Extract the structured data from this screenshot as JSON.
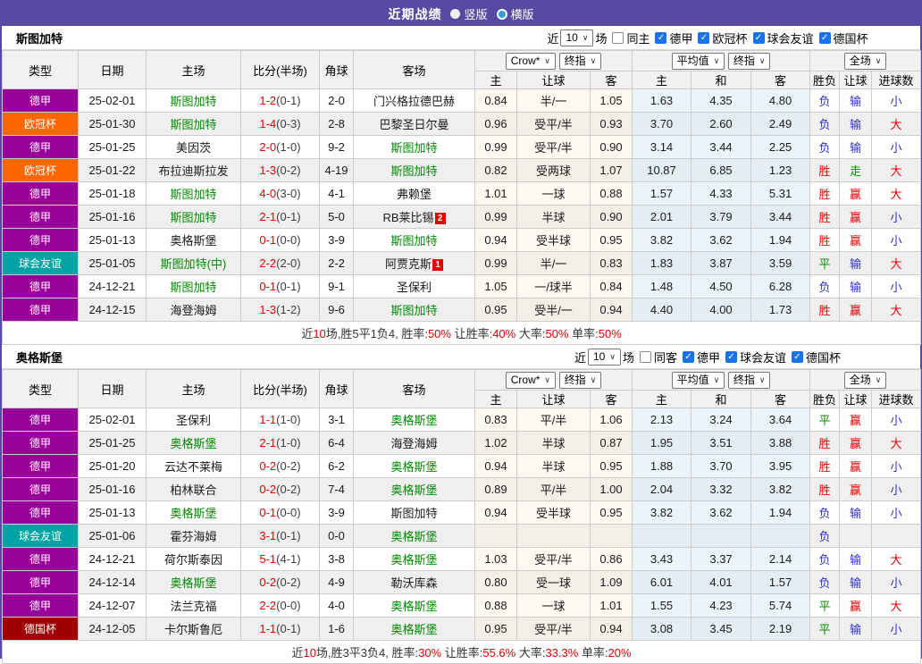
{
  "header": {
    "title": "近期战绩",
    "options": [
      {
        "label": "竖版",
        "selected": true
      },
      {
        "label": "横版",
        "selected": false
      }
    ]
  },
  "colors": {
    "titlebar_bg": "#564AA3",
    "type_colors": {
      "德甲": "#990099",
      "欧冠杯": "#FF6600",
      "球会友谊": "#00A3A3",
      "德国杯": "#A00000"
    },
    "team_highlight": "#008A00",
    "score_red": "#E60000",
    "result_colors": {
      "胜": "#E60000",
      "平": "#009000",
      "负": "#3030CF",
      "赢": "#E60000",
      "走": "#009000",
      "输": "#3030CF",
      "大": "#E60000",
      "小": "#3030CF"
    }
  },
  "columns": {
    "left": [
      "类型",
      "日期",
      "主场",
      "比分(半场)",
      "角球",
      "客场"
    ],
    "group1_selects": [
      "Crow*",
      "终指"
    ],
    "group2_selects": [
      "平均值",
      "终指"
    ],
    "group3_selects": [
      "全场"
    ],
    "sub": [
      "主",
      "让球",
      "客",
      "主",
      "和",
      "客",
      "胜负",
      "让球",
      "进球数"
    ]
  },
  "tables": [
    {
      "team": "斯图加特",
      "filter": {
        "prefix": "近",
        "matches": "10",
        "suffix": "场",
        "same_label": "同主",
        "same_checked": false,
        "leagues": [
          {
            "label": "德甲",
            "checked": true
          },
          {
            "label": "欧冠杯",
            "checked": true
          },
          {
            "label": "球会友谊",
            "checked": true
          },
          {
            "label": "德国杯",
            "checked": true
          }
        ]
      },
      "rows": [
        {
          "league": "德甲",
          "date": "25-02-01",
          "home": "斯图加特",
          "home_is_team": true,
          "score": "1-2",
          "half_score": "(0-1)",
          "corners": "2-0",
          "away": "门兴格拉德巴赫",
          "away_is_team": false,
          "away_red_card": "",
          "odds": {
            "home": "0.84",
            "handicap": "半/一",
            "away": "1.05"
          },
          "avg": {
            "home": "1.63",
            "draw": "4.35",
            "away": "4.80"
          },
          "results": {
            "outcome": "负",
            "handicap": "输",
            "goals": "小"
          }
        },
        {
          "league": "欧冠杯",
          "date": "25-01-30",
          "home": "斯图加特",
          "home_is_team": true,
          "score": "1-4",
          "half_score": "(0-3)",
          "corners": "2-8",
          "away": "巴黎圣日尔曼",
          "away_is_team": false,
          "away_red_card": "",
          "odds": {
            "home": "0.96",
            "handicap": "受平/半",
            "away": "0.93"
          },
          "avg": {
            "home": "3.70",
            "draw": "2.60",
            "away": "2.49"
          },
          "results": {
            "outcome": "负",
            "handicap": "输",
            "goals": "大"
          }
        },
        {
          "league": "德甲",
          "date": "25-01-25",
          "home": "美因茨",
          "home_is_team": false,
          "score": "2-0",
          "half_score": "(1-0)",
          "corners": "9-2",
          "away": "斯图加特",
          "away_is_team": true,
          "away_red_card": "",
          "odds": {
            "home": "0.99",
            "handicap": "受平/半",
            "away": "0.90"
          },
          "avg": {
            "home": "3.14",
            "draw": "3.44",
            "away": "2.25"
          },
          "results": {
            "outcome": "负",
            "handicap": "输",
            "goals": "小"
          }
        },
        {
          "league": "欧冠杯",
          "date": "25-01-22",
          "home": "布拉迪斯拉发",
          "home_is_team": false,
          "score": "1-3",
          "half_score": "(0-2)",
          "corners": "4-19",
          "away": "斯图加特",
          "away_is_team": true,
          "away_red_card": "",
          "odds": {
            "home": "0.82",
            "handicap": "受两球",
            "away": "1.07"
          },
          "avg": {
            "home": "10.87",
            "draw": "6.85",
            "away": "1.23"
          },
          "results": {
            "outcome": "胜",
            "handicap": "走",
            "goals": "大"
          }
        },
        {
          "league": "德甲",
          "date": "25-01-18",
          "home": "斯图加特",
          "home_is_team": true,
          "score": "4-0",
          "half_score": "(3-0)",
          "corners": "4-1",
          "away": "弗赖堡",
          "away_is_team": false,
          "away_red_card": "",
          "odds": {
            "home": "1.01",
            "handicap": "一球",
            "away": "0.88"
          },
          "avg": {
            "home": "1.57",
            "draw": "4.33",
            "away": "5.31"
          },
          "results": {
            "outcome": "胜",
            "handicap": "赢",
            "goals": "大"
          }
        },
        {
          "league": "德甲",
          "date": "25-01-16",
          "home": "斯图加特",
          "home_is_team": true,
          "score": "2-1",
          "half_score": "(0-1)",
          "corners": "5-0",
          "away": "RB莱比锡",
          "away_is_team": false,
          "away_red_card": "2",
          "odds": {
            "home": "0.99",
            "handicap": "半球",
            "away": "0.90"
          },
          "avg": {
            "home": "2.01",
            "draw": "3.79",
            "away": "3.44"
          },
          "results": {
            "outcome": "胜",
            "handicap": "赢",
            "goals": "小"
          }
        },
        {
          "league": "德甲",
          "date": "25-01-13",
          "home": "奥格斯堡",
          "home_is_team": false,
          "score": "0-1",
          "half_score": "(0-0)",
          "corners": "3-9",
          "away": "斯图加特",
          "away_is_team": true,
          "away_red_card": "",
          "odds": {
            "home": "0.94",
            "handicap": "受半球",
            "away": "0.95"
          },
          "avg": {
            "home": "3.82",
            "draw": "3.62",
            "away": "1.94"
          },
          "results": {
            "outcome": "胜",
            "handicap": "赢",
            "goals": "小"
          }
        },
        {
          "league": "球会友谊",
          "date": "25-01-05",
          "home": "斯图加特(中)",
          "home_is_team": true,
          "score": "2-2",
          "half_score": "(2-0)",
          "corners": "2-2",
          "away": "阿贾克斯",
          "away_is_team": false,
          "away_red_card": "1",
          "odds": {
            "home": "0.99",
            "handicap": "半/一",
            "away": "0.83"
          },
          "avg": {
            "home": "1.83",
            "draw": "3.87",
            "away": "3.59"
          },
          "results": {
            "outcome": "平",
            "handicap": "输",
            "goals": "大"
          }
        },
        {
          "league": "德甲",
          "date": "24-12-21",
          "home": "斯图加特",
          "home_is_team": true,
          "score": "0-1",
          "half_score": "(0-1)",
          "corners": "9-1",
          "away": "圣保利",
          "away_is_team": false,
          "away_red_card": "",
          "odds": {
            "home": "1.05",
            "handicap": "一/球半",
            "away": "0.84"
          },
          "avg": {
            "home": "1.48",
            "draw": "4.50",
            "away": "6.28"
          },
          "results": {
            "outcome": "负",
            "handicap": "输",
            "goals": "小"
          }
        },
        {
          "league": "德甲",
          "date": "24-12-15",
          "home": "海登海姆",
          "home_is_team": false,
          "score": "1-3",
          "half_score": "(1-2)",
          "corners": "9-6",
          "away": "斯图加特",
          "away_is_team": true,
          "away_red_card": "",
          "odds": {
            "home": "0.95",
            "handicap": "受半/一",
            "away": "0.94"
          },
          "avg": {
            "home": "4.40",
            "draw": "4.00",
            "away": "1.73"
          },
          "results": {
            "outcome": "胜",
            "handicap": "赢",
            "goals": "大"
          }
        }
      ],
      "summary": [
        {
          "text": "近"
        },
        {
          "text": "10",
          "red": true
        },
        {
          "text": "场,胜5平1负4, 胜率:"
        },
        {
          "text": "50%",
          "red": true
        },
        {
          "text": " 让胜率:"
        },
        {
          "text": "40%",
          "red": true
        },
        {
          "text": " 大率:"
        },
        {
          "text": "50%",
          "red": true
        },
        {
          "text": " 单率:"
        },
        {
          "text": "50%",
          "red": true
        }
      ]
    },
    {
      "team": "奥格斯堡",
      "filter": {
        "prefix": "近",
        "matches": "10",
        "suffix": "场",
        "same_label": "同客",
        "same_checked": false,
        "leagues": [
          {
            "label": "德甲",
            "checked": true
          },
          {
            "label": "球会友谊",
            "checked": true
          },
          {
            "label": "德国杯",
            "checked": true
          }
        ]
      },
      "rows": [
        {
          "league": "德甲",
          "date": "25-02-01",
          "home": "圣保利",
          "home_is_team": false,
          "score": "1-1",
          "half_score": "(1-0)",
          "corners": "3-1",
          "away": "奥格斯堡",
          "away_is_team": true,
          "away_red_card": "",
          "odds": {
            "home": "0.83",
            "handicap": "平/半",
            "away": "1.06"
          },
          "avg": {
            "home": "2.13",
            "draw": "3.24",
            "away": "3.64"
          },
          "results": {
            "outcome": "平",
            "handicap": "赢",
            "goals": "小"
          }
        },
        {
          "league": "德甲",
          "date": "25-01-25",
          "home": "奥格斯堡",
          "home_is_team": true,
          "score": "2-1",
          "half_score": "(1-0)",
          "corners": "6-4",
          "away": "海登海姆",
          "away_is_team": false,
          "away_red_card": "",
          "odds": {
            "home": "1.02",
            "handicap": "半球",
            "away": "0.87"
          },
          "avg": {
            "home": "1.95",
            "draw": "3.51",
            "away": "3.88"
          },
          "results": {
            "outcome": "胜",
            "handicap": "赢",
            "goals": "大"
          }
        },
        {
          "league": "德甲",
          "date": "25-01-20",
          "home": "云达不莱梅",
          "home_is_team": false,
          "score": "0-2",
          "half_score": "(0-2)",
          "corners": "6-2",
          "away": "奥格斯堡",
          "away_is_team": true,
          "away_red_card": "",
          "odds": {
            "home": "0.94",
            "handicap": "半球",
            "away": "0.95"
          },
          "avg": {
            "home": "1.88",
            "draw": "3.70",
            "away": "3.95"
          },
          "results": {
            "outcome": "胜",
            "handicap": "赢",
            "goals": "小"
          }
        },
        {
          "league": "德甲",
          "date": "25-01-16",
          "home": "柏林联合",
          "home_is_team": false,
          "score": "0-2",
          "half_score": "(0-2)",
          "corners": "7-4",
          "away": "奥格斯堡",
          "away_is_team": true,
          "away_red_card": "",
          "odds": {
            "home": "0.89",
            "handicap": "平/半",
            "away": "1.00"
          },
          "avg": {
            "home": "2.04",
            "draw": "3.32",
            "away": "3.82"
          },
          "results": {
            "outcome": "胜",
            "handicap": "赢",
            "goals": "小"
          }
        },
        {
          "league": "德甲",
          "date": "25-01-13",
          "home": "奥格斯堡",
          "home_is_team": true,
          "score": "0-1",
          "half_score": "(0-0)",
          "corners": "3-9",
          "away": "斯图加特",
          "away_is_team": false,
          "away_red_card": "",
          "odds": {
            "home": "0.94",
            "handicap": "受半球",
            "away": "0.95"
          },
          "avg": {
            "home": "3.82",
            "draw": "3.62",
            "away": "1.94"
          },
          "results": {
            "outcome": "负",
            "handicap": "输",
            "goals": "小"
          }
        },
        {
          "league": "球会友谊",
          "date": "25-01-06",
          "home": "霍芬海姆",
          "home_is_team": false,
          "score": "3-1",
          "half_score": "(0-1)",
          "corners": "0-0",
          "away": "奥格斯堡",
          "away_is_team": true,
          "away_red_card": "",
          "odds": {
            "home": "",
            "handicap": "",
            "away": ""
          },
          "avg": {
            "home": "",
            "draw": "",
            "away": ""
          },
          "results": {
            "outcome": "负",
            "handicap": "",
            "goals": ""
          }
        },
        {
          "league": "德甲",
          "date": "24-12-21",
          "home": "荷尔斯泰因",
          "home_is_team": false,
          "score": "5-1",
          "half_score": "(4-1)",
          "corners": "3-8",
          "away": "奥格斯堡",
          "away_is_team": true,
          "away_red_card": "",
          "odds": {
            "home": "1.03",
            "handicap": "受平/半",
            "away": "0.86"
          },
          "avg": {
            "home": "3.43",
            "draw": "3.37",
            "away": "2.14"
          },
          "results": {
            "outcome": "负",
            "handicap": "输",
            "goals": "大"
          }
        },
        {
          "league": "德甲",
          "date": "24-12-14",
          "home": "奥格斯堡",
          "home_is_team": true,
          "score": "0-2",
          "half_score": "(0-2)",
          "corners": "4-9",
          "away": "勒沃库森",
          "away_is_team": false,
          "away_red_card": "",
          "odds": {
            "home": "0.80",
            "handicap": "受一球",
            "away": "1.09"
          },
          "avg": {
            "home": "6.01",
            "draw": "4.01",
            "away": "1.57"
          },
          "results": {
            "outcome": "负",
            "handicap": "输",
            "goals": "小"
          }
        },
        {
          "league": "德甲",
          "date": "24-12-07",
          "home": "法兰克福",
          "home_is_team": false,
          "score": "2-2",
          "half_score": "(0-0)",
          "corners": "4-0",
          "away": "奥格斯堡",
          "away_is_team": true,
          "away_red_card": "",
          "odds": {
            "home": "0.88",
            "handicap": "一球",
            "away": "1.01"
          },
          "avg": {
            "home": "1.55",
            "draw": "4.23",
            "away": "5.74"
          },
          "results": {
            "outcome": "平",
            "handicap": "赢",
            "goals": "大"
          }
        },
        {
          "league": "德国杯",
          "date": "24-12-05",
          "home": "卡尔斯鲁厄",
          "home_is_team": false,
          "score": "1-1",
          "half_score": "(0-1)",
          "corners": "1-6",
          "away": "奥格斯堡",
          "away_is_team": true,
          "away_red_card": "",
          "odds": {
            "home": "0.95",
            "handicap": "受平/半",
            "away": "0.94"
          },
          "avg": {
            "home": "3.08",
            "draw": "3.45",
            "away": "2.19"
          },
          "results": {
            "outcome": "平",
            "handicap": "输",
            "goals": "小"
          }
        }
      ],
      "summary": [
        {
          "text": "近"
        },
        {
          "text": "10",
          "red": true
        },
        {
          "text": "场,胜3平3负4, 胜率:"
        },
        {
          "text": "30%",
          "red": true
        },
        {
          "text": " 让胜率:"
        },
        {
          "text": "55.6%",
          "red": true
        },
        {
          "text": " 大率:"
        },
        {
          "text": "33.3%",
          "red": true
        },
        {
          "text": " 单率:"
        },
        {
          "text": "20%",
          "red": true
        }
      ]
    }
  ]
}
